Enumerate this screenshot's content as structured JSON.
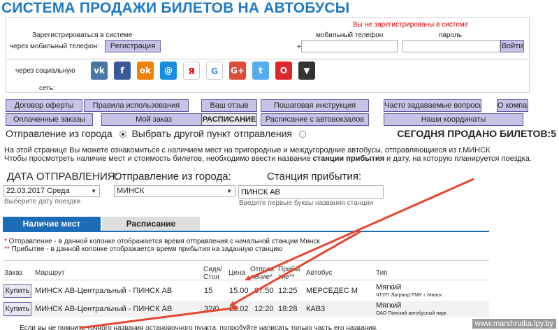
{
  "page": {
    "title": "СИСТЕМА ПРОДАЖИ БИЛЕТОВ НА АВТОБУСЫ"
  },
  "registration": {
    "warning": "Вы не зарегистрированы в системе",
    "register_label_line1": "Зарегистрироваться в системе",
    "register_label_line2": "через мобильный телефон:",
    "register_button": "Регистрация",
    "phone_label": "мобильный телефон",
    "phone_prefix": "+",
    "phone_value": "",
    "password_label": "пароль",
    "password_value": "",
    "login_button": "Войти",
    "social_label_line1": "через социальную",
    "social_label_line2": "сеть:"
  },
  "social": [
    {
      "icon": "vk-icon",
      "glyph": "vk",
      "color": "#4a76a8"
    },
    {
      "icon": "facebook-icon",
      "glyph": "f",
      "color": "#3b5998"
    },
    {
      "icon": "odnoklassniki-icon",
      "glyph": "ok",
      "color": "#ee8208"
    },
    {
      "icon": "mailru-icon",
      "glyph": "@",
      "color": "#168de2"
    },
    {
      "icon": "yandex-icon",
      "glyph": "Я",
      "color": "#ffffff"
    },
    {
      "icon": "google-icon",
      "glyph": "G",
      "color": "#ffffff"
    },
    {
      "icon": "google-plus-icon",
      "glyph": "G+",
      "color": "#dd4b39"
    },
    {
      "icon": "twitter-icon",
      "glyph": "t",
      "color": "#55acee"
    },
    {
      "icon": "opera-icon",
      "glyph": "O",
      "color": "#e0262d"
    },
    {
      "icon": "more-icon",
      "glyph": "▼",
      "color": "#333333"
    }
  ],
  "menu": {
    "row1": [
      "Договор оферты",
      "Правила использования",
      "Ваш отзыв",
      "Пошаговая инструкция",
      "Часто задаваемые вопросы",
      "О компании"
    ],
    "row2": [
      "Оплаченные заказы",
      "Мой заказ",
      "РАСПИСАНИЕ",
      "Расписание с автовокзалов",
      "Наши координаты"
    ]
  },
  "departure": {
    "option1": "Отправление из города",
    "option2": "Выбрать другой пункт отправления",
    "sold_today": "СЕГОДНЯ ПРОДАНО БИЛЕТОВ:5"
  },
  "info": {
    "line1": "На этой странице Вы можете ознакомиться с наличием мест на пригородные и междугородние автобусы, отправляющиеся из г.МИНСК",
    "line2_a": "Чтобы просмотреть наличие мест и стоимость билетов, необходимо ввести название ",
    "line2_bold": "станции прибытия",
    "line2_b": " и дату, на которую планируется поездка."
  },
  "search": {
    "date_label": "ДАТА ОТПРАВЛЕНИЯ:",
    "date_value": "22.03.2017 Среда",
    "date_hint": "Выберите дату поездки",
    "from_label": "Отправление из города:",
    "from_value": "МИНСК",
    "to_label": "Станция прибытия:",
    "to_value": "ПИНСК АВ",
    "to_hint": "Введите первые буквы названия станции"
  },
  "tabs": {
    "active": "Наличие мест",
    "inactive": "Расписание"
  },
  "notes": {
    "note1_star": "*",
    "note1": "  Отправление - в данной колонке отображается время отправления с начальной станции Минск",
    "note2_star": "**",
    "note2": " Прибытие - в данной колонке отображается время прибытия на заданную станцию"
  },
  "table": {
    "headers": {
      "order": "Заказ",
      "route": "Маршрут",
      "seats_1": "Сидя/",
      "seats_2": "Стоя",
      "price": "Цена",
      "dep_1": "Отпрaв",
      "dep_2": "ление*",
      "arr_1": "Прибы",
      "arr_2": "тие**",
      "bus": "Автобус",
      "type": "Тип"
    },
    "rows": [
      {
        "buy": "Купить",
        "route": "МИНСК АВ-Центральный - ПИНСК АВ",
        "seats": "15",
        "price": "15.00",
        "dep": "07:50",
        "arr": "12:25",
        "bus": "МЕРСЕДЕС М",
        "type": "Мягкий",
        "carrier": "ЧТУП 'Лагранд-ТМК' г. Минск"
      },
      {
        "buy": "Купить",
        "route": "МИНСК АВ-Центральный - ПИНСК АВ",
        "seats": "32/0",
        "price": "20.02",
        "dep": "12:20",
        "arr": "18:28",
        "bus": "КАВ3",
        "type": "Мягкий",
        "carrier": "ОАО Пинский автобусный парк"
      }
    ]
  },
  "footer": {
    "partial_text": "Если вы не помните точного названия остановочного пункта, попробуйте написать только часть его названия.",
    "watermark": "www.marshrutka.lpy.by"
  },
  "colors": {
    "title": "#1e7ac4",
    "tab_active": "#1d6cb8",
    "warning": "#e00000",
    "arrow": "#e8452f"
  }
}
